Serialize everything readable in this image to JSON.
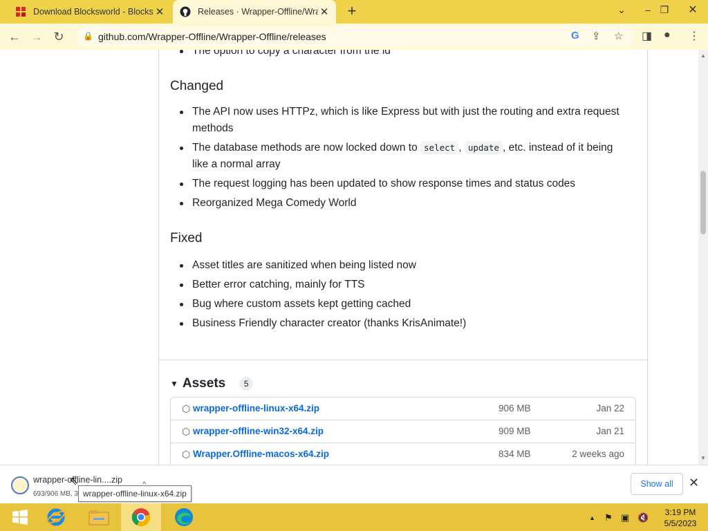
{
  "browser": {
    "tabs": [
      {
        "title": "Download Blocksworld - Blocksw",
        "active": false,
        "icon": "blocksworld-favicon"
      },
      {
        "title": "Releases · Wrapper-Offline/Wrap",
        "active": true,
        "icon": "github-icon"
      }
    ],
    "url": "github.com/Wrapper-Offline/Wrapper-Offline/releases"
  },
  "release": {
    "added_tail": [
      "The option to copy a character from the id"
    ],
    "changed_heading": "Changed",
    "changed": {
      "item1": "The API now uses HTTPz, which is like Express but with just the routing and extra request methods",
      "item2_prefix": "The database methods are now locked down to",
      "item2_code1": "select",
      "item2_sep": ",",
      "item2_code2": "update",
      "item2_suffix": ", etc. instead of it being like a normal array",
      "item3": "The request logging has been updated to show response times and status codes",
      "item4": "Reorganized Mega Comedy World"
    },
    "fixed_heading": "Fixed",
    "fixed": [
      "Asset titles are sanitized when being listed now",
      "Better error catching, mainly for TTS",
      "Bug where custom assets kept getting cached",
      "Business Friendly character creator (thanks KrisAnimate!)"
    ],
    "assets_heading": "Assets",
    "assets_count": "5",
    "assets": [
      {
        "name": "wrapper-offline-linux-x64.zip",
        "size": "906 MB",
        "date": "Jan 22"
      },
      {
        "name": "wrapper-offline-win32-x64.zip",
        "size": "909 MB",
        "date": "Jan 21"
      },
      {
        "name": "Wrapper.Offline-macos-x64.zip",
        "size": "834 MB",
        "date": "2 weeks ago"
      }
    ]
  },
  "download_bar": {
    "filename": "wrapper-offline-lin....zip",
    "progress": "693/906 MB, 3",
    "tooltip": "wrapper-offline-linux-x64.zip",
    "show_all": "Show all"
  },
  "taskbar": {
    "time": "3:19 PM",
    "date": "5/5/2023"
  }
}
